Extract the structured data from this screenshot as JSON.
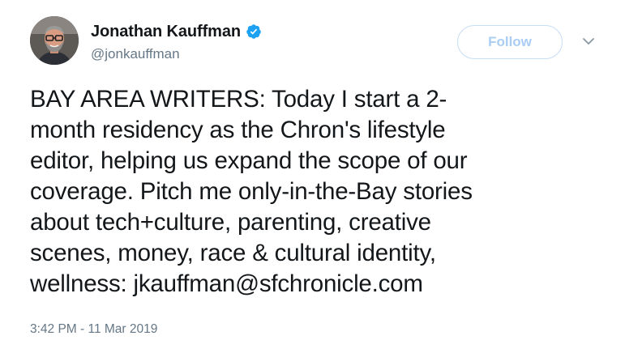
{
  "user": {
    "display_name": "Jonathan Kauffman",
    "handle": "@jonkauffman",
    "verified": true,
    "avatar_icon": "user-avatar-photo"
  },
  "actions": {
    "follow_label": "Follow",
    "menu_icon": "chevron-down-icon"
  },
  "tweet": {
    "text": "BAY AREA WRITERS: Today I start a 2-\nmonth residency as the Chron's lifestyle\neditor, helping us expand the scope of our\ncoverage. Pitch me only-in-the-Bay stories\nabout tech+culture, parenting, creative\nscenes, money, race & cultural identity,\nwellness: jkauffman@sfchronicle.com",
    "timestamp": "3:42 PM - 11 Mar 2019"
  },
  "colors": {
    "verified": "#1da1f2",
    "follow_border": "#c7ddf4",
    "follow_text": "#a9cdf3",
    "secondary_text": "#657786",
    "primary_text": "#14171a"
  }
}
